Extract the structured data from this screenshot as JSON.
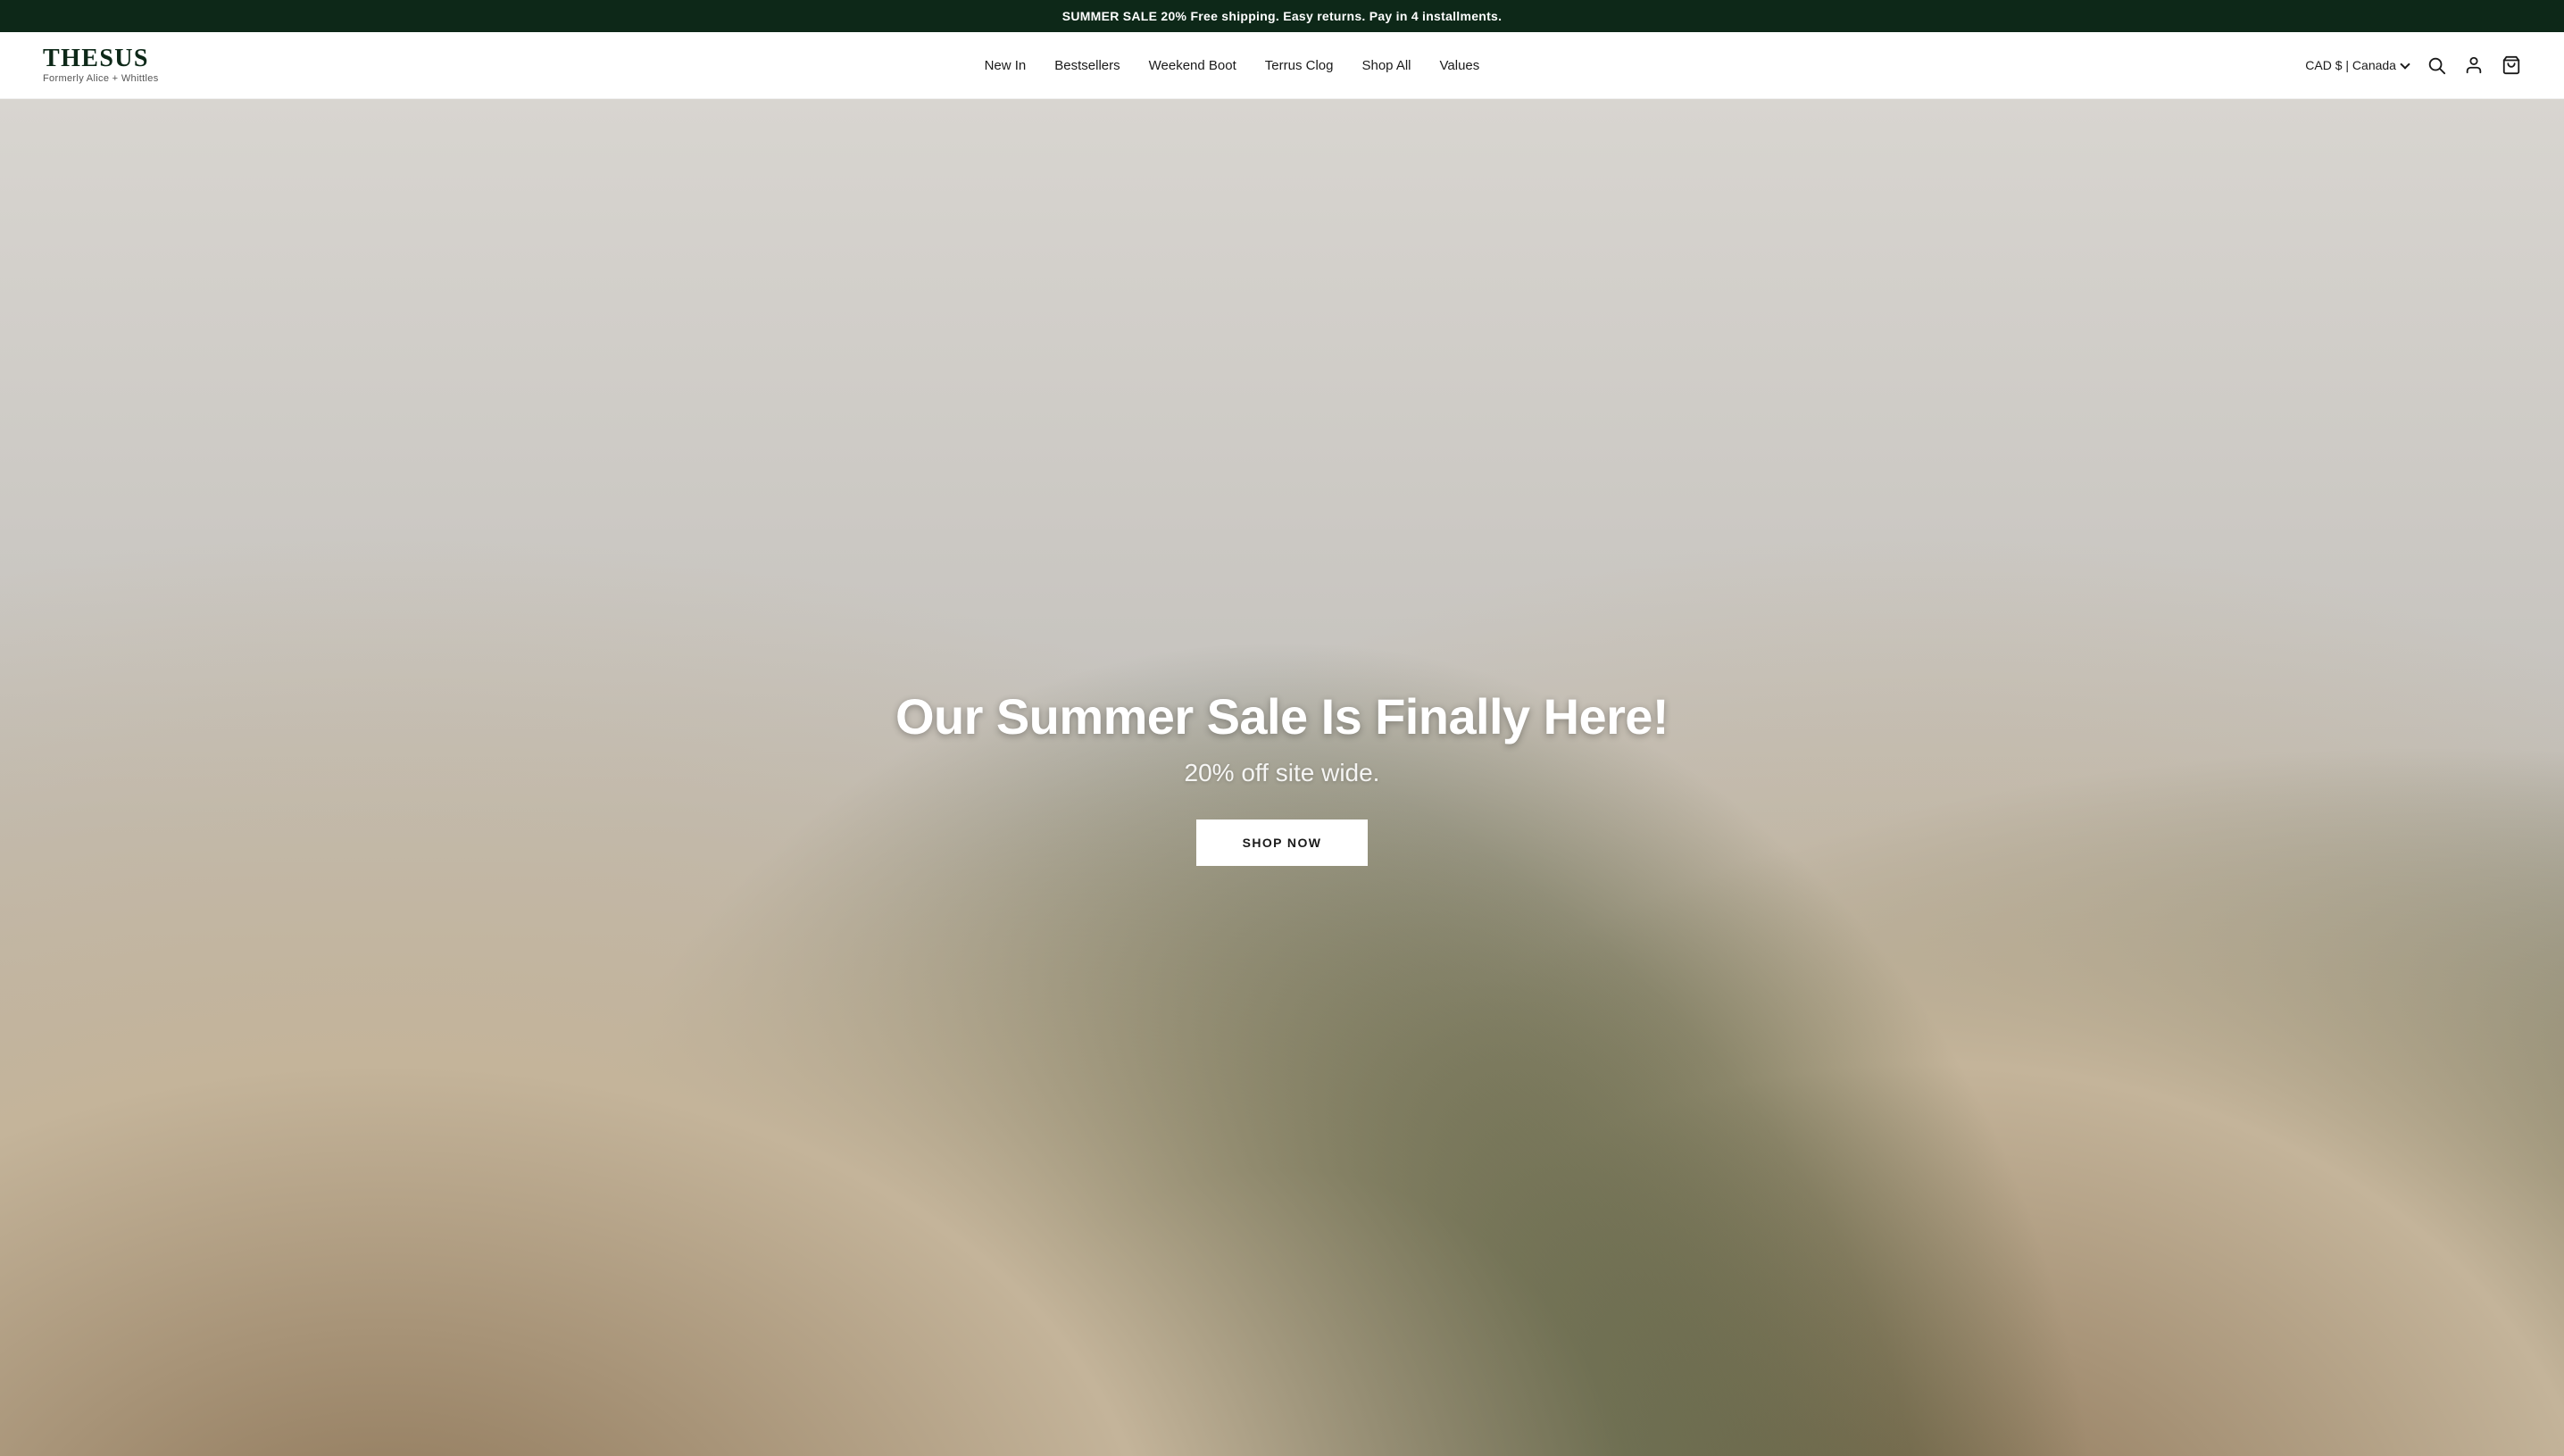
{
  "announcement": {
    "text": "SUMMER SALE 20% Free shipping. Easy returns. Pay in 4 installments."
  },
  "header": {
    "logo": {
      "name": "THESUS",
      "subtitle": "Formerly Alice + Whittles"
    },
    "nav": {
      "items": [
        {
          "label": "New In",
          "id": "new-in"
        },
        {
          "label": "Bestsellers",
          "id": "bestsellers"
        },
        {
          "label": "Weekend Boot",
          "id": "weekend-boot"
        },
        {
          "label": "Terrus Clog",
          "id": "terrus-clog"
        },
        {
          "label": "Shop All",
          "id": "shop-all"
        },
        {
          "label": "Values",
          "id": "values"
        }
      ]
    },
    "currency": {
      "label": "CAD $ | Canada",
      "chevron": "▾"
    },
    "icons": {
      "search": "search",
      "account": "account",
      "cart": "cart"
    }
  },
  "hero": {
    "title": "Our Summer Sale Is Finally Here!",
    "subtitle": "20% off site wide.",
    "cta_label": "SHOP NOW"
  }
}
